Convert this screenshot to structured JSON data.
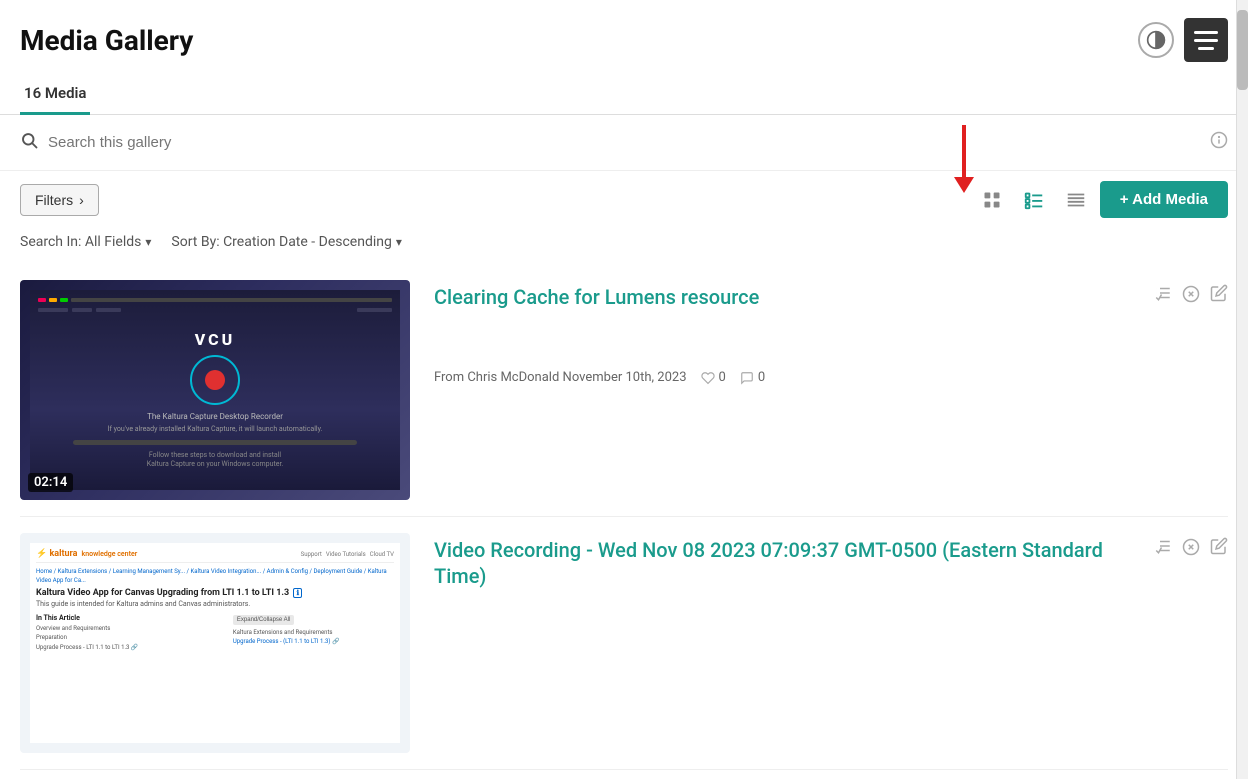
{
  "page": {
    "title": "Media Gallery"
  },
  "header": {
    "title": "Media Gallery",
    "contrast_label": "contrast",
    "menu_label": "menu"
  },
  "tabs": {
    "active": "16 Media",
    "items": [
      "16 Media"
    ]
  },
  "search": {
    "placeholder": "Search this gallery",
    "info_label": "info"
  },
  "toolbar": {
    "filters_label": "Filters",
    "filters_chevron": "›",
    "grid_view_label": "grid view",
    "list_view_label": "list view",
    "compact_view_label": "compact view",
    "add_media_label": "+ Add Media"
  },
  "filter_sort": {
    "search_in_label": "Search In: All Fields",
    "sort_by_label": "Sort By: Creation Date - Descending"
  },
  "media_items": [
    {
      "id": 1,
      "title": "Clearing Cache for Lumens resource",
      "author": "From Chris McDonald",
      "date": "November 10th, 2023",
      "likes": "0",
      "comments": "0",
      "duration": "02:14",
      "has_thumbnail": true
    },
    {
      "id": 2,
      "title": "Video Recording - Wed Nov 08 2023 07:09:37 GMT-0500 (Eastern Standard Time)",
      "author": "",
      "date": "",
      "likes": "",
      "comments": "",
      "duration": "",
      "has_thumbnail": true
    }
  ],
  "icons": {
    "search": "🔍",
    "info": "ℹ",
    "heart": "♥",
    "comment": "💬",
    "playlist": "☰",
    "remove": "✕",
    "edit": "✎",
    "chevron_right": "›",
    "chevron_down": "▾"
  }
}
